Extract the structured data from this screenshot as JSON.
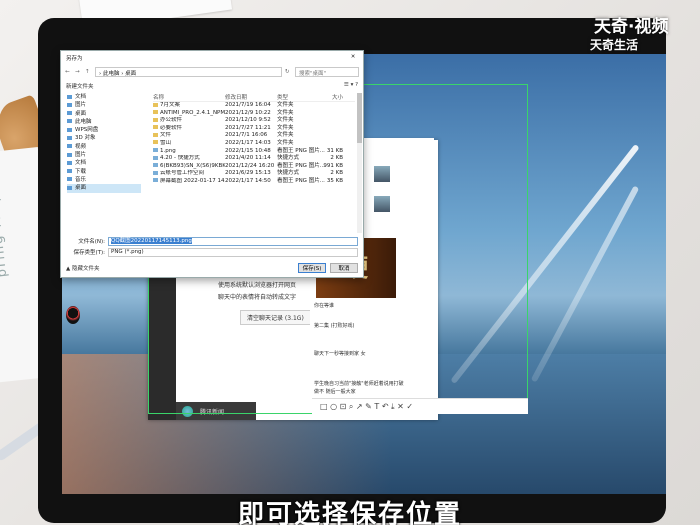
{
  "watermark": {
    "brand": "天奇·视频",
    "sub": "天奇生活"
  },
  "subtitle": "即可选择保存位置",
  "dialog": {
    "title": "另存为",
    "close_glyph": "✕",
    "path": "› 此电脑 › 桌面",
    "search_placeholder": "搜索\"桌面\"",
    "new_folder": "新建文件夹",
    "view_glyph": "☰ ▾ ?",
    "tree": [
      {
        "label": "文档"
      },
      {
        "label": "图片"
      },
      {
        "label": "桌面"
      },
      {
        "label": "此电脑"
      },
      {
        "label": "WPS网盘"
      },
      {
        "label": "3D 对象"
      },
      {
        "label": "视频"
      },
      {
        "label": "图片"
      },
      {
        "label": "文档"
      },
      {
        "label": "下载"
      },
      {
        "label": "音乐"
      },
      {
        "label": "桌面"
      }
    ],
    "columns": {
      "name": "名称",
      "date": "修改日期",
      "type": "类型",
      "size": "大小"
    },
    "files": [
      {
        "name": "7月文案",
        "date": "2021/7/19 16:04",
        "type": "文件夹",
        "size": "",
        "kind": "folder"
      },
      {
        "name": "ANTIMI_PRO_2.4.1_NPM64",
        "date": "2021/12/9 10:22",
        "type": "文件夹",
        "size": "",
        "kind": "folder"
      },
      {
        "name": "办公软件",
        "date": "2021/12/10 9:52",
        "type": "文件夹",
        "size": "",
        "kind": "folder"
      },
      {
        "name": "必要软件",
        "date": "2021/7/27 11:21",
        "type": "文件夹",
        "size": "",
        "kind": "folder"
      },
      {
        "name": "文件",
        "date": "2021/7/1 16:06",
        "type": "文件夹",
        "size": "",
        "kind": "folder"
      },
      {
        "name": "雪山",
        "date": "2022/1/17 14:03",
        "type": "文件夹",
        "size": "",
        "kind": "folder"
      },
      {
        "name": "1.png",
        "date": "2022/1/15 10:48",
        "type": "看图王 PNG 图片...",
        "size": "31 KB",
        "kind": "file"
      },
      {
        "name": "4.20 - 快捷方式",
        "date": "2021/4/20 11:14",
        "type": "快捷方式",
        "size": "2 KB",
        "kind": "file"
      },
      {
        "name": "6(BKB93)SN_X(S6)9KBKD.png",
        "date": "2021/12/24 16:20",
        "type": "看图王 PNG 图片...",
        "size": "991 KB",
        "kind": "file"
      },
      {
        "name": "云账号管工作空间",
        "date": "2021/6/29 15:13",
        "type": "快捷方式",
        "size": "2 KB",
        "kind": "file"
      },
      {
        "name": "屏幕截图 2022-01-17 145024.png",
        "date": "2022/1/17 14:50",
        "type": "看图王 PNG 图片...",
        "size": "35 KB",
        "kind": "file"
      }
    ],
    "filename_label": "文件名(N):",
    "filename_value": "QQ截图20220117145113.png",
    "filetype_label": "保存类型(T):",
    "filetype_value": "PNG (*.png)",
    "hide_folders": "▲ 隐藏文件夹",
    "save_label": "保存(S)",
    "cancel_label": "取消"
  },
  "chat": {
    "tips": [
      "使用系统默认浏览器打开网页",
      "聊天中的表情将自动转成文字"
    ],
    "storage_button": "清空聊天记录 (3.1G)",
    "bottom_item": "腾讯新闻"
  },
  "feed": {
    "banner_text": "硬",
    "lines": [
      "你在等谁",
      "第二集 (打败好戏)",
      "聊天下一秒等接到家 女",
      "学生晚自习当前\"接触\"老师赶着说用打破",
      "做不 随后一般大家"
    ]
  },
  "annot_toolbar": {
    "icons": "□ ○ ⊡ ⌕ ↗ ✎ T ↶ ⤓ ✕ ✓"
  }
}
